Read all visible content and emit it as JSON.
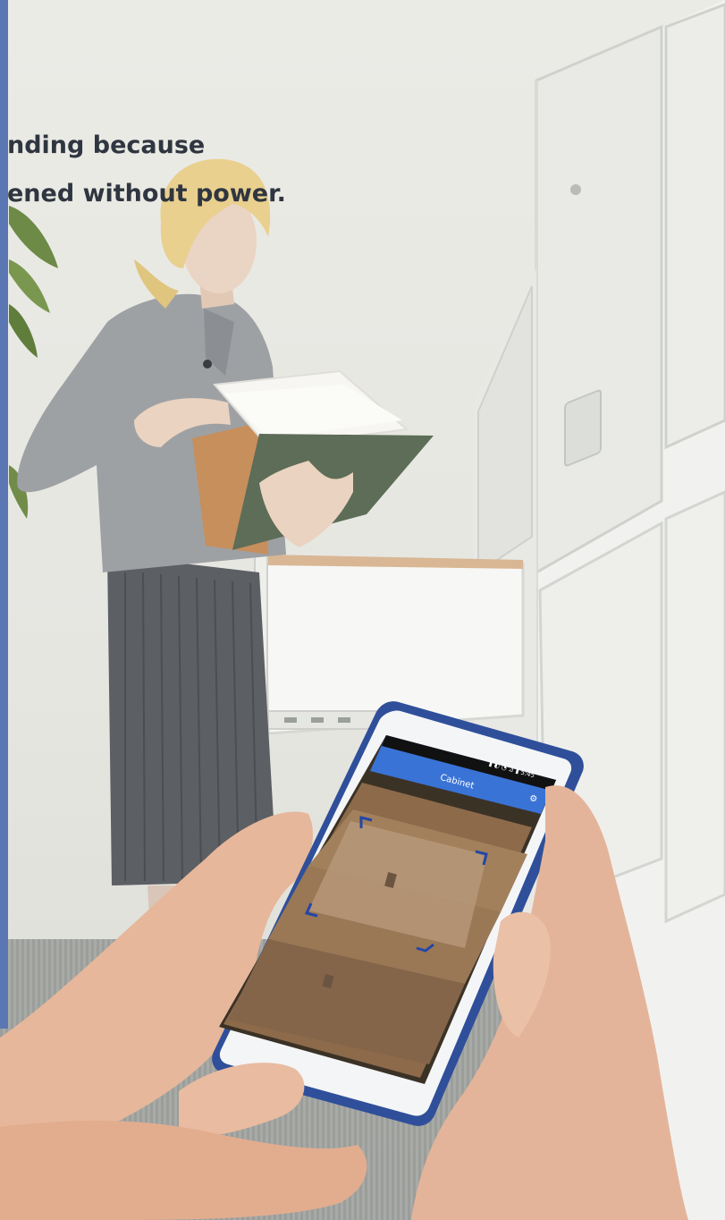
{
  "headline": {
    "line1": "nding because",
    "line2": "ened without power."
  },
  "phone": {
    "app_title": "Cabinet",
    "status_bar": "▮ ◐ ◔ ⊿ ▮ 5:45",
    "settings_icon": "gear-icon",
    "accent_color": "#3a73d6",
    "frame_color": "#2f4f9a"
  },
  "colors": {
    "page_left_edge": "#5a77b3",
    "text": "#2f3640",
    "wall": "#e8e8e3",
    "cabinet": "#f2f3f1"
  }
}
